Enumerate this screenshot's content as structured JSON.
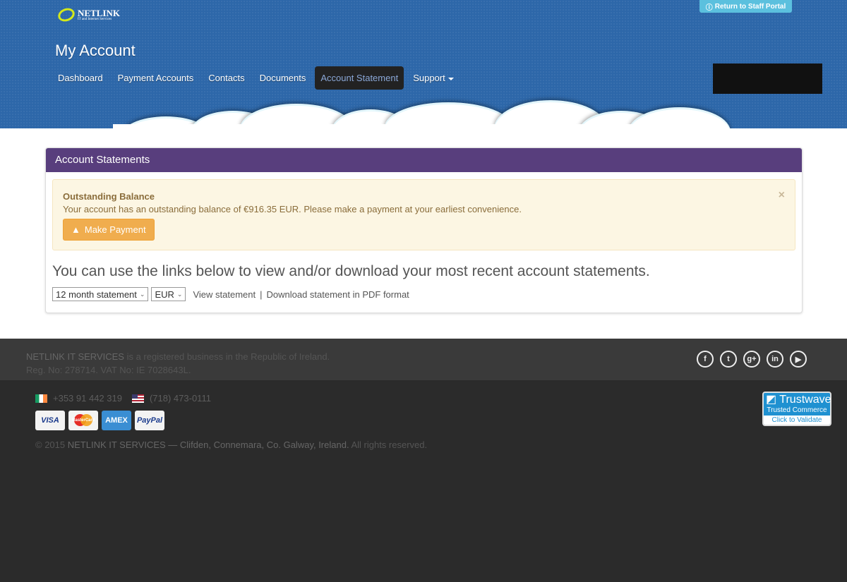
{
  "header": {
    "logo_name": "NETLINK",
    "logo_tagline": "IT and Internet Services",
    "staff_portal": "Return to Staff Portal",
    "title": "My Account",
    "nav": [
      {
        "label": "Dashboard"
      },
      {
        "label": "Payment Accounts"
      },
      {
        "label": "Contacts"
      },
      {
        "label": "Documents"
      },
      {
        "label": "Account Statement",
        "active": true
      },
      {
        "label": "Support",
        "dropdown": true
      }
    ]
  },
  "panel": {
    "title": "Account Statements",
    "alert": {
      "heading": "Outstanding Balance",
      "message": "Your account has an outstanding balance of €916.35 EUR. Please make a payment at your earliest convenience.",
      "button": "Make Payment",
      "close": "×"
    },
    "lead": "You can use the links below to view and/or download your most recent account statements.",
    "period_select": "12 month statement",
    "currency_select": "EUR",
    "view_link": "View statement",
    "separator": "|",
    "download_link": "Download statement in PDF format"
  },
  "footer": {
    "company": "NETLINK IT SERVICES",
    "registered": " is a registered business in the Republic of Ireland.",
    "reg": "Reg. No: 278714. VAT No: IE 7028643L.",
    "social": [
      "facebook",
      "twitter",
      "google-plus",
      "linkedin",
      "youtube"
    ],
    "phone_ie": "+353 91 442 319",
    "phone_us": "(718) 473-0111",
    "cards": [
      "VISA",
      "MasterCard",
      "AMEX",
      "PayPal"
    ],
    "copy_pre": "© 2015 ",
    "copy_company": "NETLINK IT SERVICES — Clifden, Connemara, Co. Galway, Ireland.",
    "copy_post": " All rights reserved.",
    "trustwave": {
      "brand": "Trustwave",
      "line1": "Trusted Commerce",
      "line2": "Click to Validate"
    }
  },
  "colors": {
    "header": "#2d67a9",
    "panel_header": "#583e7d",
    "warning": "#f0ad4e",
    "footer": "#2b2b2b"
  }
}
